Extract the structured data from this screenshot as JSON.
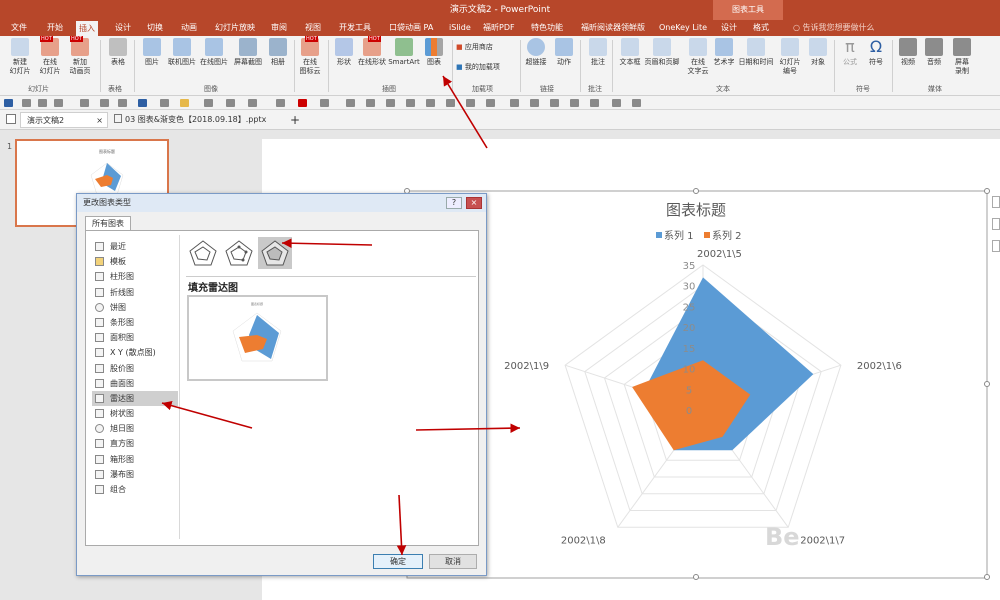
{
  "window": {
    "title": "演示文稿2 - PowerPoint",
    "chart_tools": "图表工具"
  },
  "tabs": [
    "文件",
    "开始",
    "插入",
    "设计",
    "切换",
    "动画",
    "幻灯片放映",
    "审阅",
    "视图",
    "开发工具",
    "口袋动画 PA",
    "iSlide",
    "福昕PDF",
    "特色功能",
    "福昕阅读器领鲜版",
    "OneKey Lite",
    "设计",
    "格式"
  ],
  "tell_me": "告诉我您想要做什么",
  "ribbon": {
    "buttons": [
      "新建\n幻灯片",
      "在线\n幻灯片",
      "新加\n动画页",
      "表格",
      "图片",
      "联机图片",
      "在线图片",
      "屏幕截图",
      "相册",
      "在线\n图标云",
      "形状",
      "在线形状",
      "SmartArt",
      "图表",
      "超链接",
      "动作",
      "批注",
      "文本框",
      "页眉和页脚",
      "在线\n文字云",
      "艺术字",
      "日期和时间",
      "幻灯片\n编号",
      "对象",
      "公式",
      "符号",
      "视频",
      "音频",
      "屏幕\n录制"
    ],
    "small": [
      "应用商店",
      "我的加载项"
    ],
    "groups": [
      "幻灯片",
      "表格",
      "图像",
      "插图",
      "加载项",
      "链接",
      "批注",
      "文本",
      "符号",
      "媒体"
    ],
    "hot_badge": "HOT"
  },
  "doc_tabs": [
    "演示文稿2",
    "03 图表&渐变色【2018.09.18】.pptx"
  ],
  "new_tab": "+",
  "thumb_number": "1",
  "dialog": {
    "title": "更改图表类型",
    "help": "?",
    "close": "×",
    "tab": "所有图表",
    "types": [
      "最近",
      "模板",
      "柱形图",
      "折线图",
      "饼图",
      "条形图",
      "面积图",
      "X Y (散点图)",
      "股价图",
      "曲面图",
      "雷达图",
      "树状图",
      "旭日图",
      "直方图",
      "箱形图",
      "瀑布图",
      "组合"
    ],
    "selected_type": "雷达图",
    "subtype_title": "填充雷达图",
    "ok": "确定",
    "cancel": "取消"
  },
  "colors": {
    "series1": "#5b9bd5",
    "series2": "#ed7d31",
    "accent": "#b7472a",
    "arrow": "#c00000"
  },
  "chart_data": {
    "type": "radar",
    "title": "图表标题",
    "categories": [
      "2002\\1\\5",
      "2002\\1\\6",
      "2002\\1\\7",
      "2002\\1\\8",
      "2002\\1\\9"
    ],
    "series": [
      {
        "name": "系列 1",
        "values": [
          32,
          28,
          12,
          12,
          15
        ]
      },
      {
        "name": "系列 2",
        "values": [
          12,
          12,
          8,
          12,
          18
        ]
      }
    ],
    "ticks": [
      "0",
      "5",
      "10",
      "15",
      "20",
      "25",
      "30",
      "35"
    ],
    "rmax": 35,
    "legend": "top",
    "watermark": "Be"
  }
}
